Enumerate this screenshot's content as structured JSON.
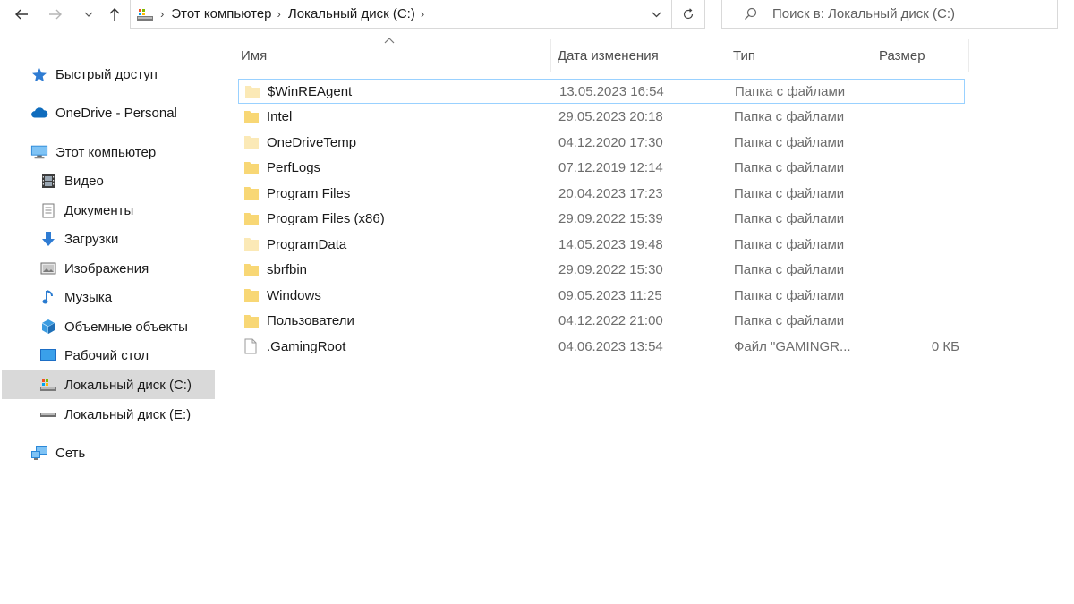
{
  "address_bar": {
    "breadcrumbs": [
      "Этот компьютер",
      "Локальный диск (C:)"
    ]
  },
  "search": {
    "placeholder": "Поиск в: Локальный диск (C:)"
  },
  "sidebar": {
    "items": [
      {
        "label": "Быстрый доступ",
        "icon": "star-icon"
      },
      {
        "label": "OneDrive - Personal",
        "icon": "cloud-icon"
      },
      {
        "label": "Этот компьютер",
        "icon": "computer-icon"
      },
      {
        "label": "Видео",
        "icon": "video-icon"
      },
      {
        "label": "Документы",
        "icon": "documents-icon"
      },
      {
        "label": "Загрузки",
        "icon": "download-icon"
      },
      {
        "label": "Изображения",
        "icon": "images-icon"
      },
      {
        "label": "Музыка",
        "icon": "music-icon"
      },
      {
        "label": "Объемные объекты",
        "icon": "3d-objects-icon"
      },
      {
        "label": "Рабочий стол",
        "icon": "desktop-icon"
      },
      {
        "label": "Локальный диск (C:)",
        "icon": "system-drive-icon",
        "selected": true
      },
      {
        "label": "Локальный диск (E:)",
        "icon": "drive-icon"
      },
      {
        "label": "Сеть",
        "icon": "network-icon"
      }
    ]
  },
  "columns": {
    "name": "Имя",
    "date": "Дата изменения",
    "type": "Тип",
    "size": "Размер"
  },
  "files": [
    {
      "name": "$WinREAgent",
      "date": "13.05.2023 16:54",
      "type": "Папка с файлами",
      "size": "",
      "kind": "folder-faded"
    },
    {
      "name": "Intel",
      "date": "29.05.2023 20:18",
      "type": "Папка с файлами",
      "size": "",
      "kind": "folder"
    },
    {
      "name": "OneDriveTemp",
      "date": "04.12.2020 17:30",
      "type": "Папка с файлами",
      "size": "",
      "kind": "folder-faded"
    },
    {
      "name": "PerfLogs",
      "date": "07.12.2019 12:14",
      "type": "Папка с файлами",
      "size": "",
      "kind": "folder"
    },
    {
      "name": "Program Files",
      "date": "20.04.2023 17:23",
      "type": "Папка с файлами",
      "size": "",
      "kind": "folder"
    },
    {
      "name": "Program Files (x86)",
      "date": "29.09.2022 15:39",
      "type": "Папка с файлами",
      "size": "",
      "kind": "folder"
    },
    {
      "name": "ProgramData",
      "date": "14.05.2023 19:48",
      "type": "Папка с файлами",
      "size": "",
      "kind": "folder-faded"
    },
    {
      "name": "sbrfbin",
      "date": "29.09.2022 15:30",
      "type": "Папка с файлами",
      "size": "",
      "kind": "folder"
    },
    {
      "name": "Windows",
      "date": "09.05.2023 11:25",
      "type": "Папка с файлами",
      "size": "",
      "kind": "folder"
    },
    {
      "name": "Пользователи",
      "date": "04.12.2022 21:00",
      "type": "Папка с файлами",
      "size": "",
      "kind": "folder"
    },
    {
      "name": ".GamingRoot",
      "date": "04.06.2023 13:54",
      "type": "Файл \"GAMINGR...",
      "size": "0 КБ",
      "kind": "file"
    }
  ],
  "colors": {
    "folder": "#f8d775",
    "folder_faded": "#fbe9b6",
    "selection": "#d9d9d9",
    "focus_border": "#99d1ff"
  }
}
